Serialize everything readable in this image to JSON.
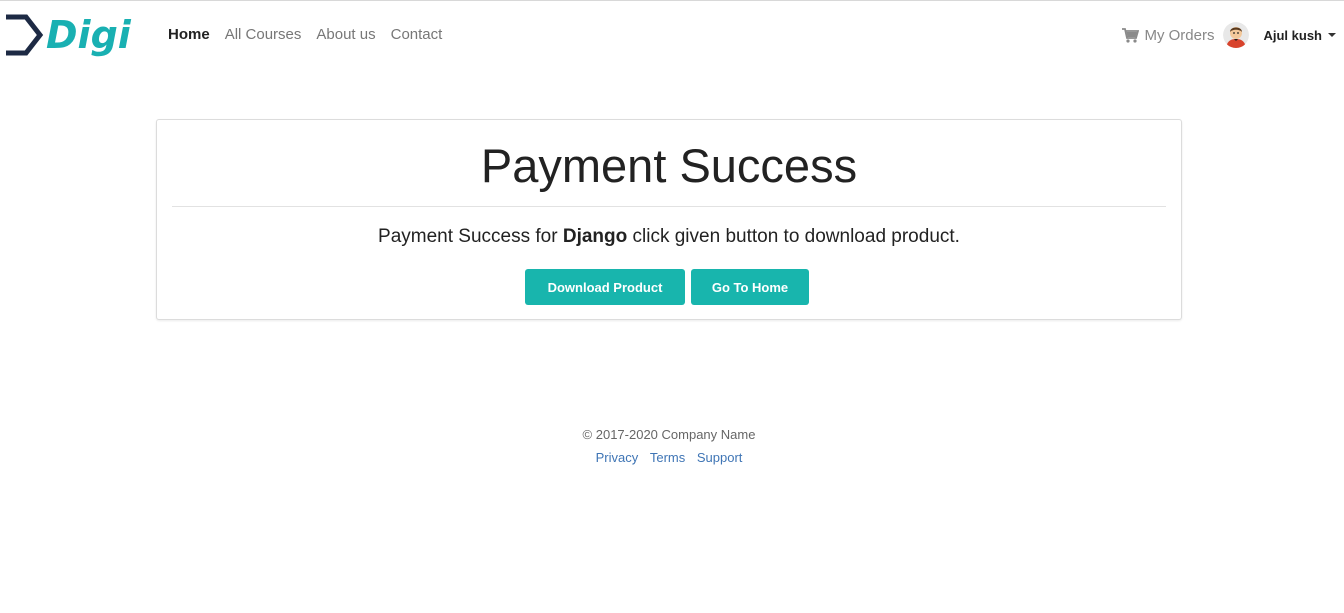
{
  "brand": {
    "name": "Digi",
    "icon": "digi-logo-icon",
    "colors": {
      "accent": "#19b0b2",
      "mark": "#1d2a44"
    }
  },
  "nav": {
    "links": [
      {
        "label": "Home",
        "active": true
      },
      {
        "label": "All Courses",
        "active": false
      },
      {
        "label": "About us",
        "active": false
      },
      {
        "label": "Contact",
        "active": false
      }
    ],
    "orders_label": "My Orders",
    "orders_icon": "cart-icon",
    "avatar_icon": "user-avatar-icon",
    "user_name": "Ajul kush"
  },
  "panel": {
    "title": "Payment Success",
    "message_prefix": "Payment Success for",
    "product_name": "Django",
    "message_suffix": "click given button to download product.",
    "download_label": "Download Product",
    "home_label": "Go To Home",
    "button_color": "#18b5ad"
  },
  "footer": {
    "copyright": "© 2017-2020 Company Name",
    "links": [
      "Privacy",
      "Terms",
      "Support"
    ],
    "link_color": "#3f75b5"
  }
}
